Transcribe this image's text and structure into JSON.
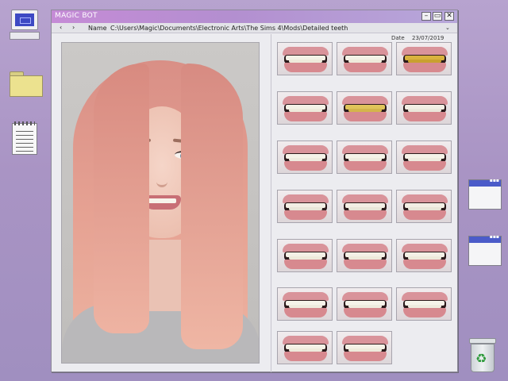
{
  "window": {
    "title": "MAGIC BOT",
    "controls": {
      "minimize": "–",
      "maximize": "▭",
      "close": "✕"
    }
  },
  "address": {
    "back": "‹",
    "forward": "›",
    "label": "Name",
    "path": "C:\\Users\\Magic\\Documents\\Electronic Arts\\The Sims 4\\Mods\\Detailed teeth",
    "dropdown": "⌄"
  },
  "meta": {
    "date_label": "Date",
    "date_value": "23/07/2019"
  },
  "colors": {
    "titlebar_start": "#c58bd6",
    "titlebar_end": "#b7a7da",
    "desktop": "#a994c4",
    "window_bg": "#ececf0"
  },
  "desktop_icons": [
    "computer-icon",
    "folder-icon",
    "notepad-icon",
    "window-icon",
    "window-icon",
    "recycle-bin-icon"
  ],
  "teeth_variants": [
    {
      "teeth": "#f4f1e6",
      "lower": "#eeeadb"
    },
    {
      "teeth": "#f4f1e6",
      "lower": "#eeeadb"
    },
    {
      "teeth": "#d9b23d",
      "lower": "#c9a02f"
    },
    {
      "teeth": "#f4f1e6",
      "lower": "#eeeadb"
    },
    {
      "teeth": "#e0c45a",
      "lower": "#d4b54b"
    },
    {
      "teeth": "#f2eee4",
      "lower": "#ebe7da"
    },
    {
      "teeth": "#f5f2e8",
      "lower": "#efebdf"
    },
    {
      "teeth": "#f5f2e8",
      "lower": "#efebdf"
    },
    {
      "teeth": "#f5f2e8",
      "lower": "#efebdf"
    },
    {
      "teeth": "#f3efe5",
      "lower": "#eae6d9"
    },
    {
      "teeth": "#f3efe5",
      "lower": "#eae6d9"
    },
    {
      "teeth": "#f3efe5",
      "lower": "#eae6d9"
    },
    {
      "teeth": "#f4f1e6",
      "lower": "#eeeadb"
    },
    {
      "teeth": "#f4f1e6",
      "lower": "#eeeadb"
    },
    {
      "teeth": "#f4f1e6",
      "lower": "#eeeadb"
    },
    {
      "teeth": "#f6f3ea",
      "lower": "#efebdf"
    },
    {
      "teeth": "#f6f3ea",
      "lower": "#efebdf"
    },
    {
      "teeth": "#f6f3ea",
      "lower": "#efebdf"
    },
    {
      "teeth": "#f4f1e6",
      "lower": "#eeeadb"
    },
    {
      "teeth": "#f4f1e6",
      "lower": "#eeeadb"
    }
  ]
}
